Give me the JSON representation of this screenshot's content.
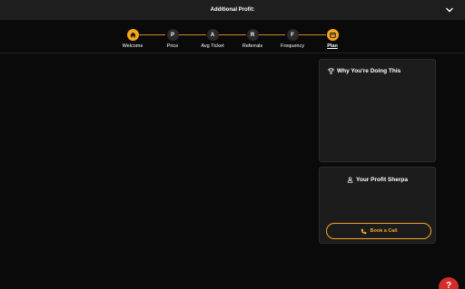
{
  "header": {
    "title": "Additional Profit:",
    "toggle_icon": "chevron-down-icon"
  },
  "steps": [
    {
      "letter": "",
      "icon": "home-icon",
      "label": "Welcome",
      "state": "done"
    },
    {
      "letter": "P",
      "label": "Price",
      "state": "pending"
    },
    {
      "letter": "A",
      "label": "Avg Ticket",
      "state": "pending"
    },
    {
      "letter": "R",
      "label": "Referrals",
      "state": "pending"
    },
    {
      "letter": "F",
      "label": "Frequency",
      "state": "pending"
    },
    {
      "letter": "",
      "icon": "calendar-icon",
      "label": "Plan",
      "state": "current"
    }
  ],
  "why_card": {
    "title": "Why You're Doing This",
    "icon": "trophy-icon"
  },
  "sherpa_card": {
    "title": "Your Profit Sherpa",
    "icon": "user-icon",
    "button_label": "Book a Call",
    "button_icon": "phone-icon"
  },
  "help": {
    "label": "?"
  },
  "colors": {
    "accent": "#f5a623",
    "background": "#0a0a0a",
    "panel": "#1c1c1c",
    "help": "#d62b2b"
  }
}
